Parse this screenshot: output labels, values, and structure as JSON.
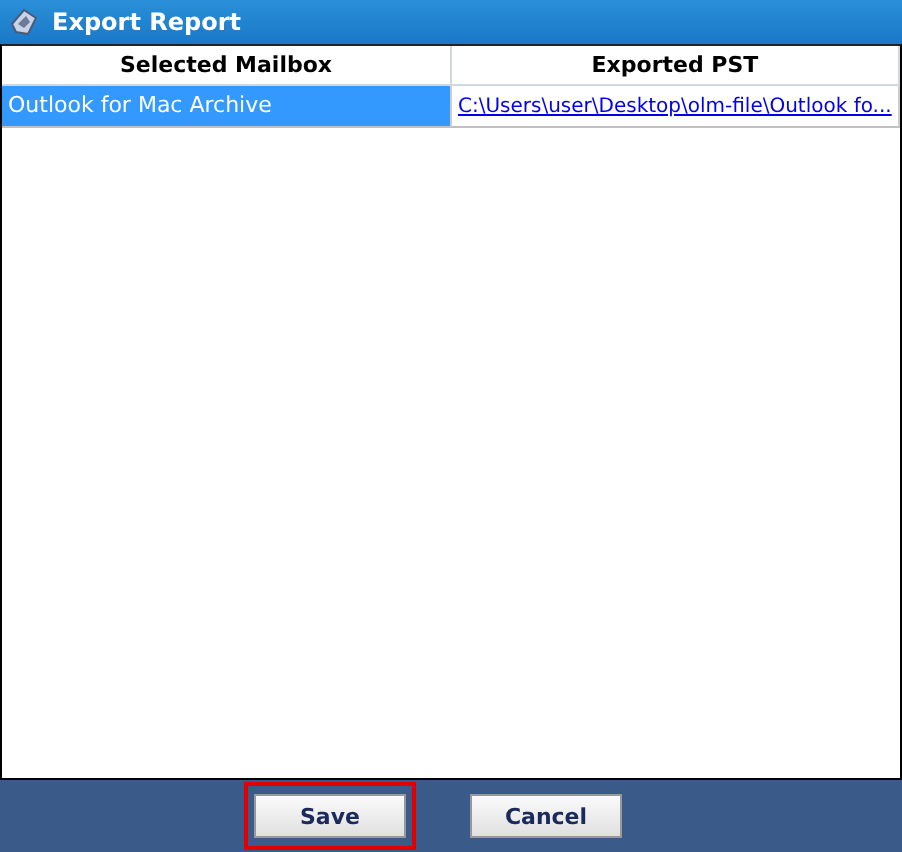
{
  "window": {
    "title": "Export Report"
  },
  "table": {
    "columns": [
      "Selected Mailbox",
      "Exported PST"
    ],
    "rows": [
      {
        "mailbox": "Outlook for Mac Archive",
        "path": "C:\\Users\\user\\Desktop\\olm-file\\Outlook fo...",
        "selected": true
      }
    ]
  },
  "buttons": [
    {
      "label": "Save",
      "highlighted": true
    },
    {
      "label": "Cancel",
      "highlighted": false
    }
  ]
}
